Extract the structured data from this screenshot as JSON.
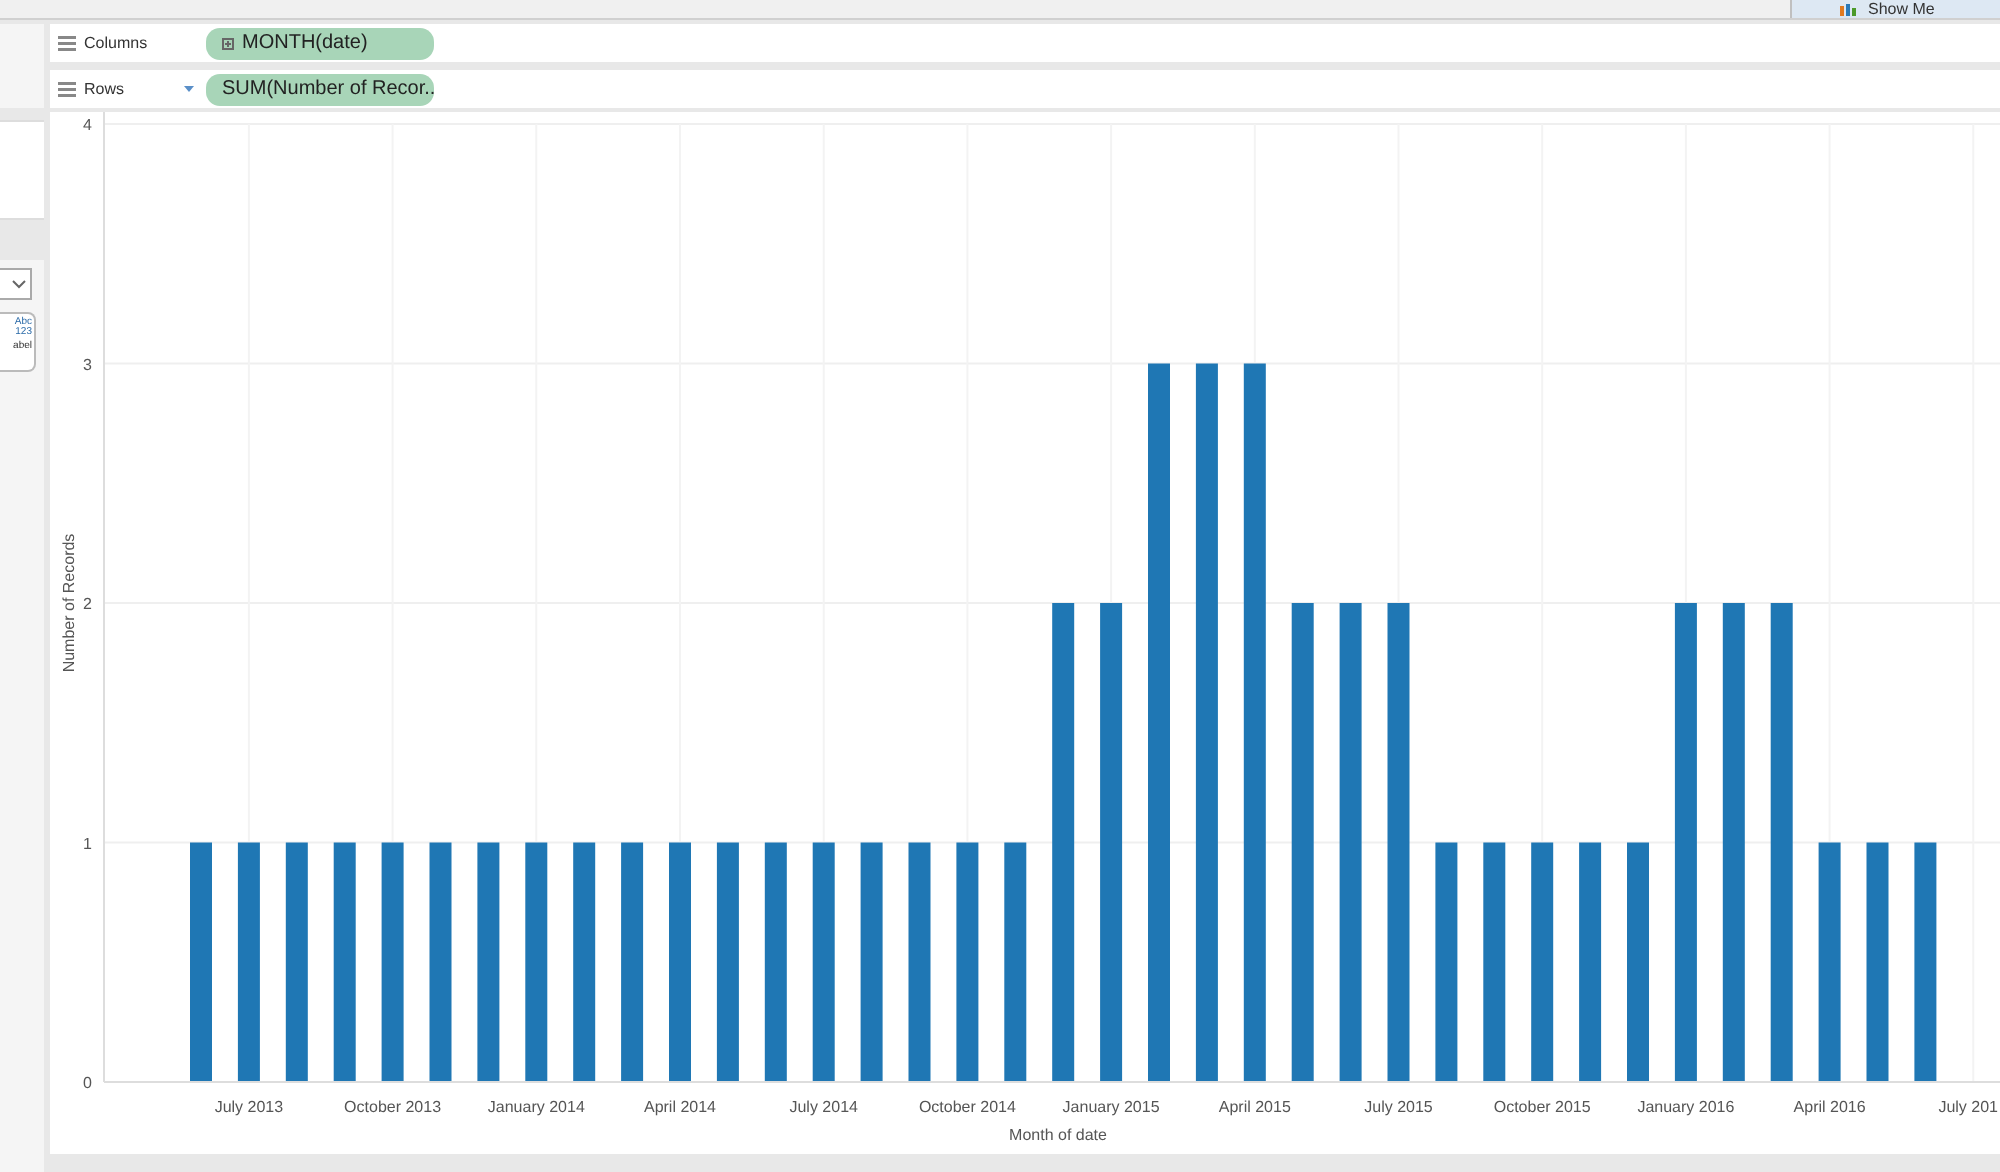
{
  "toolbar": {
    "show_me": "Show Me"
  },
  "side_card": {
    "lines": [
      "Abc",
      "123"
    ],
    "caption": "abel"
  },
  "shelves": [
    {
      "label": "Columns",
      "pill": "MONTH(date)",
      "pill_icon": true,
      "dropdown": false
    },
    {
      "label": "Rows",
      "pill": "SUM(Number of Recor..",
      "pill_icon": false,
      "dropdown": true
    }
  ],
  "chart_data": {
    "type": "bar",
    "xlabel": "Month of date",
    "ylabel": "Number of Records",
    "categories": [
      null,
      "July 2013",
      null,
      null,
      "October 2013",
      null,
      null,
      "January 2014",
      null,
      null,
      "April 2014",
      null,
      null,
      "July 2014",
      null,
      null,
      "October 2014",
      null,
      null,
      "January 2015",
      null,
      null,
      "April 2015",
      null,
      null,
      "July 2015",
      null,
      null,
      "October 2015",
      null,
      null,
      "January 2016",
      null,
      null,
      "April 2016",
      null,
      null,
      "July 201"
    ],
    "grid": true,
    "series": [
      {
        "color": "#1f77b4",
        "values": [
          1,
          1,
          1,
          1,
          1,
          1,
          1,
          1,
          1,
          1,
          1,
          1,
          1,
          1,
          1,
          1,
          1,
          1,
          2,
          2,
          3,
          3,
          3,
          2,
          2,
          2,
          1,
          1,
          1,
          1,
          1,
          2,
          2,
          2,
          1,
          1,
          1,
          null
        ]
      }
    ],
    "ylim": [
      0,
      4
    ],
    "yticks": [
      0,
      1,
      2,
      3,
      4
    ]
  }
}
